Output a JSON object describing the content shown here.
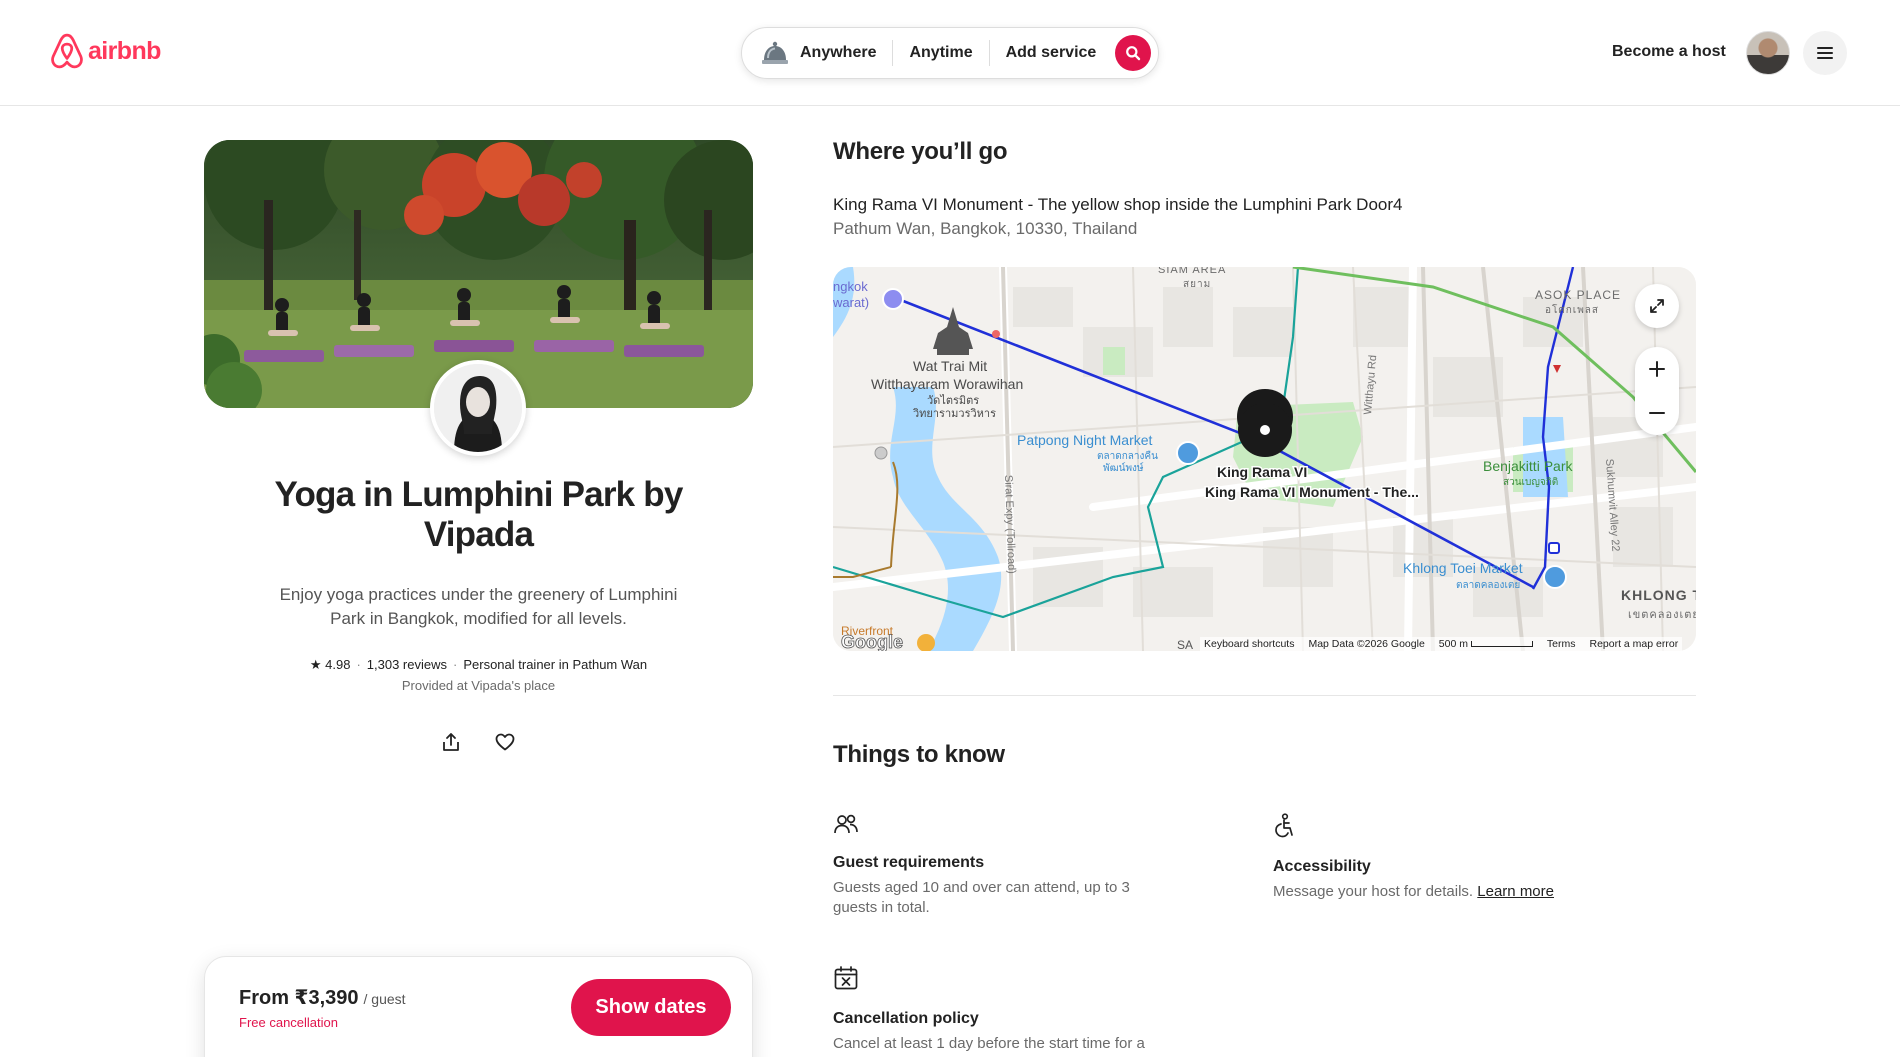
{
  "header": {
    "logo_text": "airbnb",
    "search": {
      "where": "Anywhere",
      "when": "Anytime",
      "what": "Add service"
    },
    "become_host": "Become a host"
  },
  "experience": {
    "title": "Yoga in Lumphini Park by Vipada",
    "description": "Enjoy yoga practices under the greenery of Lumphini Park in Bangkok, modified for all levels.",
    "rating": "★ 4.98",
    "reviews": "1,303 reviews",
    "host_role": "Personal trainer in Pathum Wan",
    "provided_at": "Provided at Vipada's place"
  },
  "booking": {
    "price": "From ₹3,390",
    "price_unit": "/ guest",
    "free_cancellation": "Free cancellation",
    "show_dates": "Show dates"
  },
  "location": {
    "section_title": "Where you’ll go",
    "address_line1": "King Rama VI Monument - The yellow shop inside the Lumphini Park Door4",
    "address_line2": "Pathum Wan, Bangkok, 10330, Thailand",
    "map": {
      "pin_label": "King Rama VI Monument - The...",
      "labels": {
        "siam": "SIAM AREA",
        "siam_th": "สยาม",
        "asok": "ASOK PLACE",
        "asok_th": "อโศกเพลส",
        "bangkok_partial": "ngkok",
        "waratt_partial": "warat)",
        "wat_trai_mit": "Wat Trai Mit",
        "witthayaram": "Witthayaram Worawihan",
        "wat_th1": "วัดไตรมิตร",
        "wat_th2": "วิทยารามวรวิหาร",
        "patpong": "Patpong Night Market",
        "patpong_th": "ตลาดกลางคืน",
        "patpong_th2": "พัฒน์พงษ์",
        "benjakitti": "Benjakitti Park",
        "benjakitti_th": "สวนเบญจกิติ",
        "khlong_toei_market": "Khlong Toei Market",
        "khlong_toei_market_th": "ตลาดคลองเตย",
        "khlong_toei": "KHLONG TOEI",
        "khlong_toei_th": "เขตคลองเตย",
        "sirat_expy": "Sirat Expy (Tollroad)",
        "witthayu": "Witthayu Rd",
        "sukhumvit": "Sukhumvit Alley 22",
        "riverfront": "Riverfront",
        "sa": "SA",
        "google": "Google"
      },
      "footer": {
        "shortcuts": "Keyboard shortcuts",
        "map_data": "Map Data ©2026 Google",
        "scale": "500 m",
        "terms": "Terms",
        "report": "Report a map error"
      }
    }
  },
  "things_to_know": {
    "section_title": "Things to know",
    "guest_requirements": {
      "label": "Guest requirements",
      "text": "Guests aged 10 and over can attend, up to 3 guests in total."
    },
    "accessibility": {
      "label": "Accessibility",
      "text": "Message your host for details.",
      "link": "Learn more"
    },
    "cancellation": {
      "label": "Cancellation policy",
      "text": "Cancel at least 1 day before the start time for a"
    }
  },
  "colors": {
    "brand": "#ff385c",
    "cta": "#e0144c"
  }
}
